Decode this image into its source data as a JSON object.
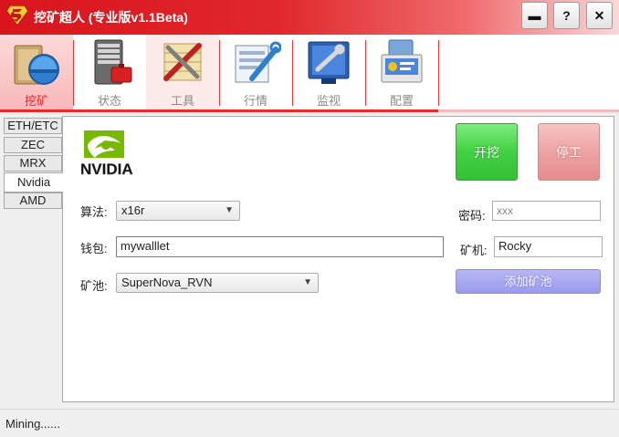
{
  "window": {
    "title": "挖矿超人 (专业版v1.1Beta)",
    "buttons": {
      "minimize": "▬",
      "help": "?",
      "close": "✕"
    }
  },
  "tabs": [
    {
      "label": "挖矿",
      "icon": "miner-helmet-icon",
      "selected": true
    },
    {
      "label": "状态",
      "icon": "server-status-icon"
    },
    {
      "label": "工具",
      "icon": "tools-icon"
    },
    {
      "label": "行情",
      "icon": "market-chart-icon"
    },
    {
      "label": "监视",
      "icon": "monitor-wrench-icon"
    },
    {
      "label": "配置",
      "icon": "settings-config-icon"
    }
  ],
  "sidebar": {
    "items": [
      {
        "label": "ETH/ETC"
      },
      {
        "label": "ZEC"
      },
      {
        "label": "MRX"
      },
      {
        "label": "Nvidia",
        "selected": true
      },
      {
        "label": "AMD"
      }
    ]
  },
  "main": {
    "brand_logo": "NVIDIA",
    "algorithm": {
      "label": "算法:",
      "value": "x16r"
    },
    "wallet": {
      "label": "钱包:",
      "value": "mywalllet"
    },
    "pool": {
      "label": "矿池:",
      "value": "SuperNova_RVN"
    },
    "password": {
      "label": "密码:",
      "placeholder": "xxx"
    },
    "worker": {
      "label": "矿机:",
      "value": "Rocky"
    },
    "start_label": "开挖",
    "stop_label": "停工",
    "add_pool_label": "添加矿池"
  },
  "status_bar": {
    "text": "Mining......"
  },
  "colors": {
    "titlebar": "#d9141c",
    "start": "#42d142",
    "stop": "#eda2a2",
    "add_pool": "#9a9aee"
  }
}
